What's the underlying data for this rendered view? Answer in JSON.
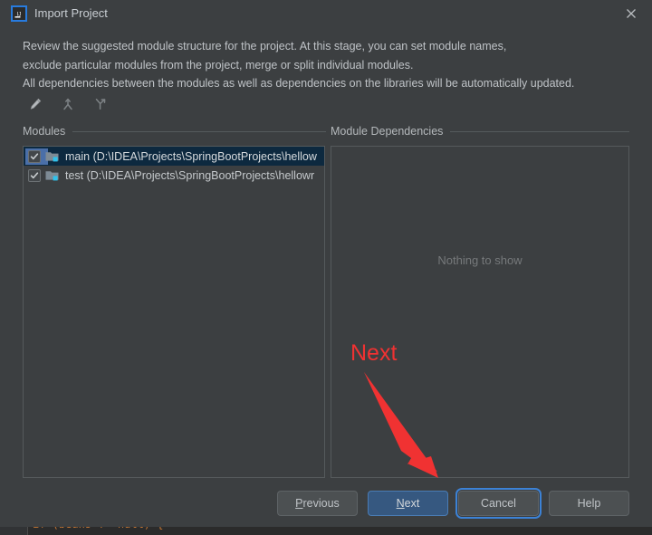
{
  "window": {
    "title": "Import Project",
    "app_icon": "intellij-idea-icon",
    "close_icon": "close-icon"
  },
  "description": {
    "line1": "Review the suggested module structure for the project. At this stage, you can set module names,",
    "line2": "exclude particular modules from the project, merge or split individual modules.",
    "line3": "All dependencies between the modules as well as dependencies on the libraries will be automatically updated."
  },
  "toolbar": {
    "items": [
      {
        "icon": "edit-pencil-icon",
        "tooltip": "Edit"
      },
      {
        "icon": "merge-modules-icon",
        "tooltip": "Merge"
      },
      {
        "icon": "split-module-icon",
        "tooltip": "Split"
      }
    ]
  },
  "modules_panel": {
    "header": "Modules",
    "rows": [
      {
        "checked": true,
        "selected": true,
        "label": "main (D:\\IDEA\\Projects\\SpringBootProjects\\hellow",
        "icon": "module-folder-icon"
      },
      {
        "checked": true,
        "selected": false,
        "label": "test (D:\\IDEA\\Projects\\SpringBootProjects\\hellowr",
        "icon": "module-folder-icon"
      }
    ]
  },
  "dependencies_panel": {
    "header": "Module Dependencies",
    "empty_text": "Nothing to show"
  },
  "annotation": {
    "label": "Next",
    "color": "#f03232",
    "arrow": "red-arrow-pointing-to-next-button"
  },
  "buttons": {
    "previous": {
      "label": "Previous",
      "mnemonic": "P"
    },
    "next": {
      "label": "Next",
      "mnemonic": "N"
    },
    "cancel": {
      "label": "Cancel"
    },
    "help": {
      "label": "Help"
    }
  },
  "background_editor": {
    "code_fragment": "if (beans != null) {"
  },
  "colors": {
    "dialog_bg": "#3c3f41",
    "panel_border": "#555a5c",
    "selection_bg": "#0d293f",
    "primary_button": "#365880",
    "accent": "#287bde",
    "annotation_red": "#f03232"
  }
}
